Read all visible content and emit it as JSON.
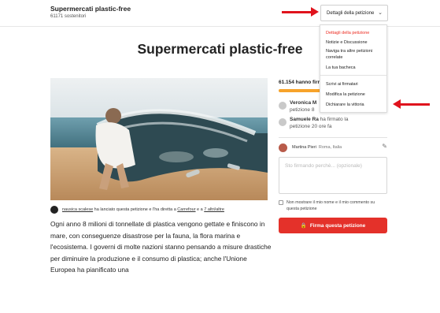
{
  "header": {
    "petition_name": "Supermercati plastic-free",
    "supporters": "61171 sostenitori",
    "details_button": "Dettagli della petizione"
  },
  "menu": {
    "items": [
      {
        "label": "Dettagli della petizione",
        "active": true
      },
      {
        "label": "Notizie e Discussione",
        "active": false
      },
      {
        "label": "Naviga tra altre petizioni correlate",
        "active": false
      },
      {
        "label": "La tua bacheca",
        "active": false
      },
      {
        "label": "Scrivi ai firmatari",
        "active": false
      },
      {
        "label": "Modifica la petizione",
        "active": false
      },
      {
        "label": "Dichiarare la vittoria",
        "active": false
      }
    ]
  },
  "petition": {
    "title": "Supermercati plastic-free",
    "author": "nausica scalese",
    "author_text_1": " ha lanciato questa petizione e l'ha diretta a ",
    "target_1": "Carrefour",
    "author_text_2": " e a ",
    "target_2": "7 altri/altre",
    "body": "Ogni anno 8 milioni di tonnellate di plastica vengono gettate e finiscono in mare, con conseguenze disastrose per la fauna, la flora marina e l'ecosistema. I governi di molte nazioni stanno pensando a misure drastiche per diminuire la produzione e il consumo di plastica; anche l'Unione Europea ha pianificato una"
  },
  "signatures": {
    "count_text": "61.154 hanno firm",
    "progress": 0.82,
    "recent": [
      {
        "name": "Veronica M",
        "detail": "petizione 8"
      },
      {
        "name": "Samuele Ra",
        "detail": "petizione 20 ore fa",
        "name_suffix": "ha firmato la"
      }
    ]
  },
  "current_user": {
    "name": "Martina Pieri",
    "location": "Roma, Italia"
  },
  "form": {
    "reason_placeholder": "Sto firmando perchè... (opzionale)",
    "hide_label": "Non mostrare il mio nome e il mio commento su questa petizione",
    "sign_button": "Firma questa petizione"
  },
  "colors": {
    "accent": "#ec2c22",
    "button": "#e4312a",
    "progress": "#f7a32b",
    "arrow": "#e0131d"
  }
}
